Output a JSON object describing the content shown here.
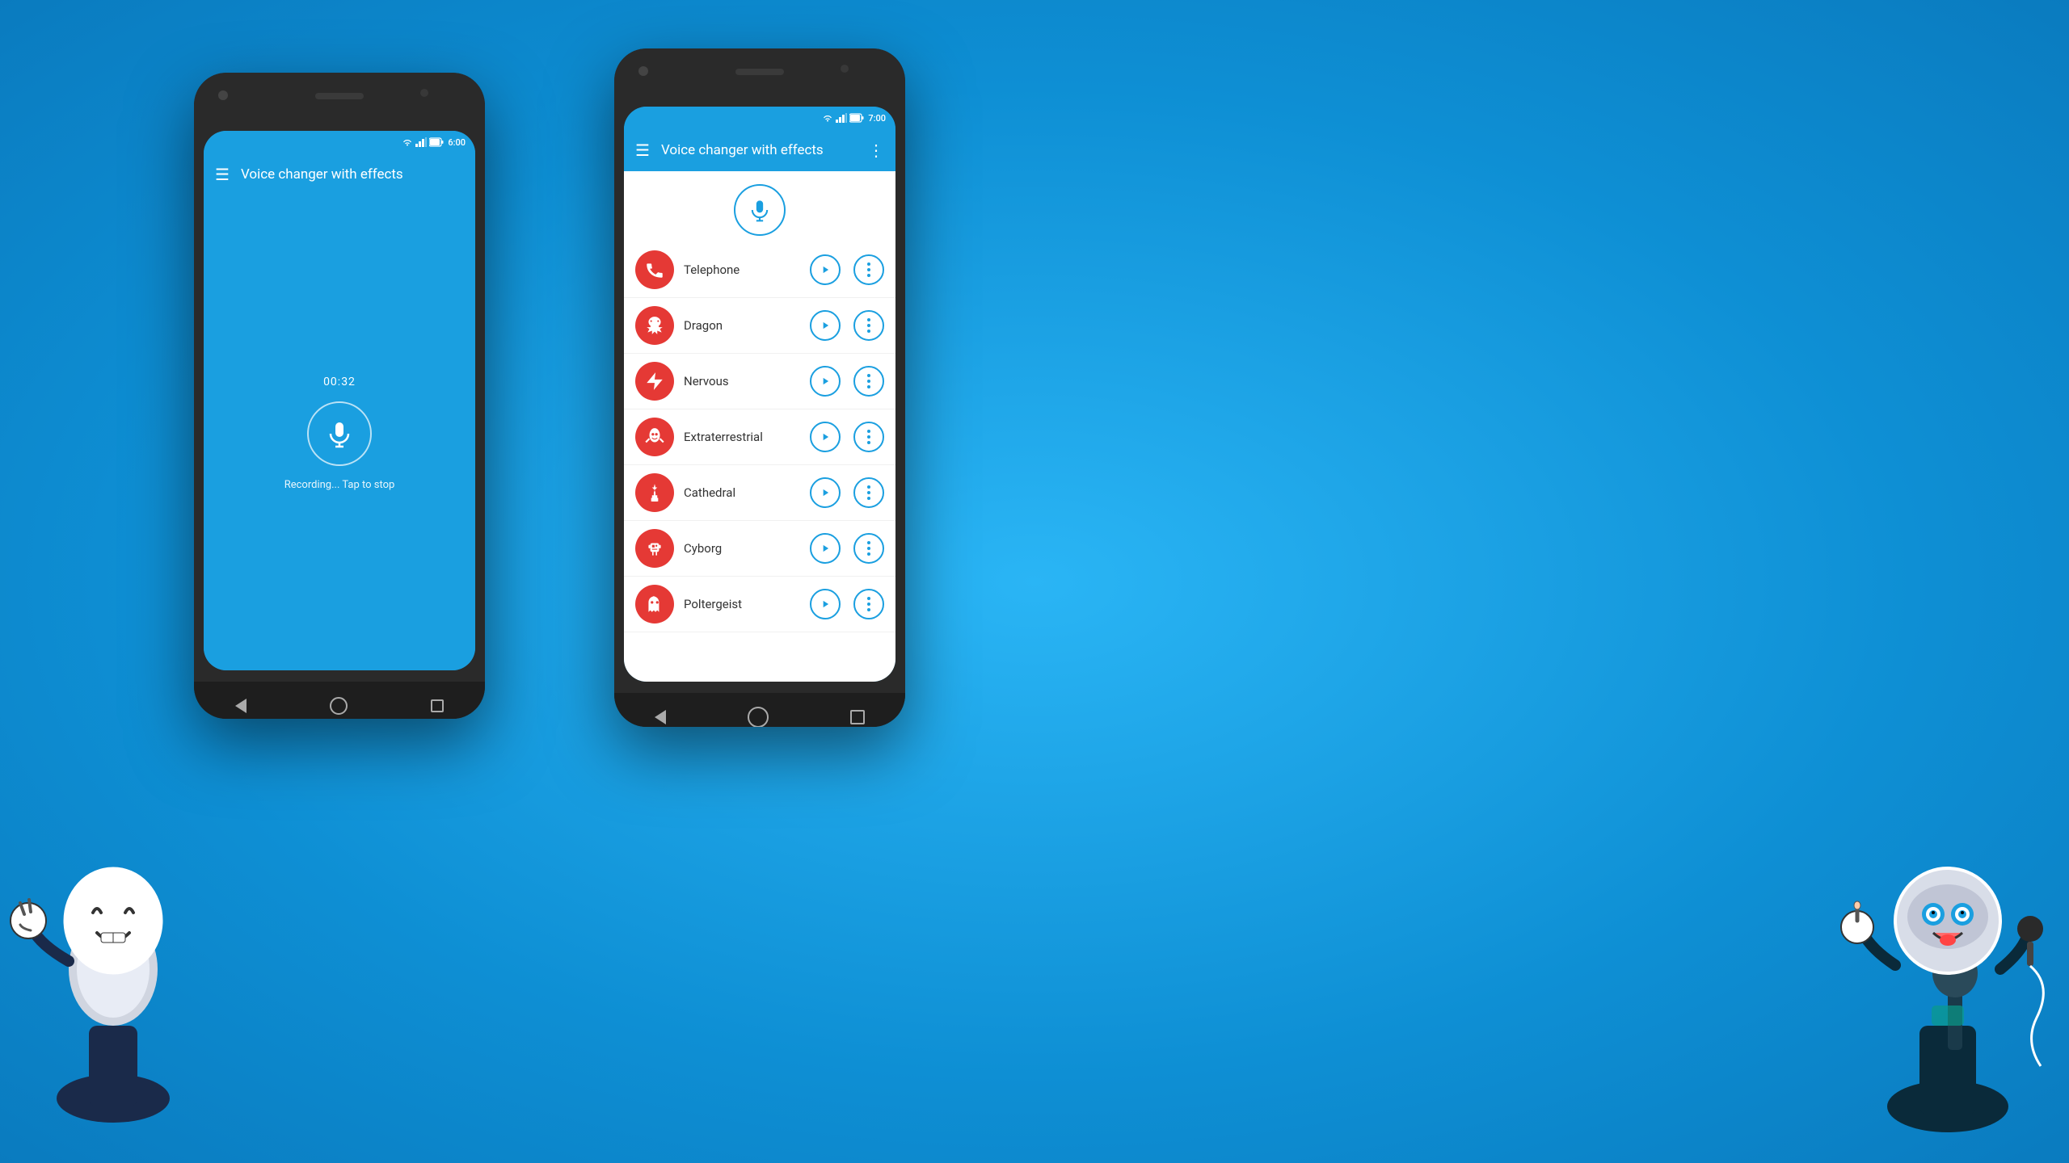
{
  "background": {
    "color": "#1a9fe0"
  },
  "left_phone": {
    "status_bar": {
      "time": "6:00",
      "wifi_icon": "wifi",
      "signal_icon": "signal",
      "battery_icon": "battery"
    },
    "app_bar": {
      "menu_label": "☰",
      "title": "Voice changer with effects"
    },
    "screen": {
      "recording_time": "00:32",
      "recording_text": "Recording... Tap to stop",
      "mic_icon": "🎙"
    },
    "nav": {
      "back": "◁",
      "home": "",
      "recent": ""
    }
  },
  "right_phone": {
    "status_bar": {
      "time": "7:00",
      "wifi_icon": "wifi",
      "signal_icon": "signal",
      "battery_icon": "battery"
    },
    "app_bar": {
      "menu_label": "☰",
      "title": "Voice changer with effects",
      "more_label": "⋮"
    },
    "effects": [
      {
        "id": "telephone",
        "name": "Telephone",
        "icon": "📞"
      },
      {
        "id": "dragon",
        "name": "Dragon",
        "icon": "🐉"
      },
      {
        "id": "nervous",
        "name": "Nervous",
        "icon": "⚡"
      },
      {
        "id": "extraterrestrial",
        "name": "Extraterrestrial",
        "icon": "👽"
      },
      {
        "id": "cathedral",
        "name": "Cathedral",
        "icon": "⛪"
      },
      {
        "id": "cyborg",
        "name": "Cyborg",
        "icon": "🤖"
      },
      {
        "id": "poltergeist",
        "name": "Poltergeist",
        "icon": "👻"
      }
    ],
    "nav": {
      "back": "◁",
      "home": "",
      "recent": ""
    }
  }
}
